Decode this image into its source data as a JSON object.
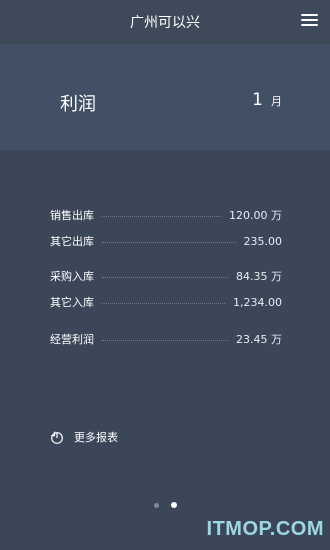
{
  "header": {
    "title": "广州可以兴",
    "menu_icon": "hamburger-menu-icon"
  },
  "hero": {
    "label": "利润",
    "month_number": "1",
    "month_unit": "月"
  },
  "stats": [
    {
      "label": "销售出库",
      "value": "120.00 万"
    },
    {
      "label": "其它出库",
      "value": "235.00"
    },
    {
      "label": "采购入库",
      "value": "84.35 万"
    },
    {
      "label": "其它入库",
      "value": "1,234.00"
    },
    {
      "label": "经营利润",
      "value": "23.45 万"
    }
  ],
  "more_reports": {
    "label": "更多报表",
    "icon": "pie-chart-icon"
  },
  "pager": {
    "count": 2,
    "active_index": 1
  },
  "watermark": "ITMOP.COM",
  "colors": {
    "background": "#3b4758",
    "hero_band": "#415064",
    "watermark": "#9ed7e3"
  }
}
